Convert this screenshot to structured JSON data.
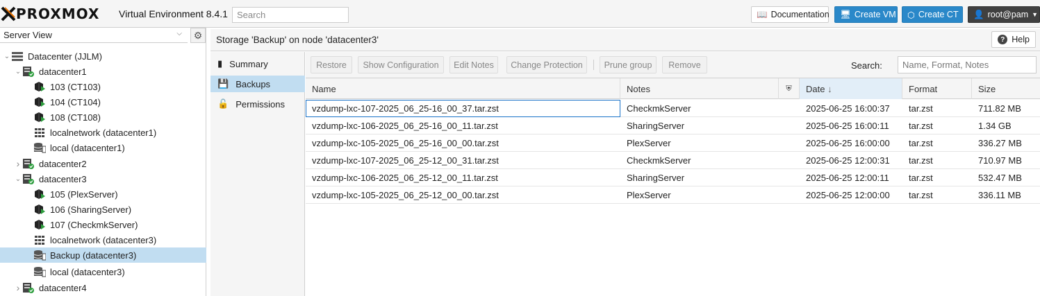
{
  "header": {
    "logo": "PROXMOX",
    "version": "Virtual Environment 8.4.1",
    "search_placeholder": "Search",
    "documentation": "Documentation",
    "create_vm": "Create VM",
    "create_ct": "Create CT",
    "user": "root@pam",
    "colors": {
      "accent": "#2a88c9",
      "logo_x": "#e57000"
    }
  },
  "sidebar": {
    "view": "Server View",
    "tree": [
      {
        "label": "Datacenter (JJLM)",
        "icon": "datacenter-icon",
        "expanded": true
      },
      {
        "label": "datacenter1",
        "icon": "node-icon",
        "expanded": true
      },
      {
        "label": "103 (CT103)",
        "icon": "container-running-icon"
      },
      {
        "label": "104 (CT104)",
        "icon": "container-running-icon"
      },
      {
        "label": "108 (CT108)",
        "icon": "container-running-icon"
      },
      {
        "label": "localnetwork (datacenter1)",
        "icon": "network-icon"
      },
      {
        "label": "local (datacenter1)",
        "icon": "storage-icon"
      },
      {
        "label": "datacenter2",
        "icon": "node-icon",
        "expanded": false
      },
      {
        "label": "datacenter3",
        "icon": "node-icon",
        "expanded": true
      },
      {
        "label": "105 (PlexServer)",
        "icon": "container-running-icon"
      },
      {
        "label": "106 (SharingServer)",
        "icon": "container-running-icon"
      },
      {
        "label": "107 (CheckmkServer)",
        "icon": "container-running-icon"
      },
      {
        "label": "localnetwork (datacenter3)",
        "icon": "network-icon"
      },
      {
        "label": "Backup (datacenter3)",
        "icon": "storage-icon",
        "selected": true
      },
      {
        "label": "local (datacenter3)",
        "icon": "storage-icon"
      },
      {
        "label": "datacenter4",
        "icon": "node-icon",
        "expanded": false
      }
    ]
  },
  "content": {
    "title": "Storage 'Backup' on node 'datacenter3'",
    "help": "Help",
    "nav": [
      {
        "label": "Summary",
        "icon": "book-icon"
      },
      {
        "label": "Backups",
        "icon": "floppy-icon",
        "selected": true
      },
      {
        "label": "Permissions",
        "icon": "unlock-icon"
      }
    ],
    "toolbar": {
      "restore": "Restore",
      "show_config": "Show Configuration",
      "edit_notes": "Edit Notes",
      "change_protection": "Change Protection",
      "prune_group": "Prune group",
      "remove": "Remove",
      "search_label": "Search:",
      "search_placeholder": "Name, Format, Notes"
    },
    "columns": [
      "Name",
      "Notes",
      "",
      "Date",
      "Format",
      "Size"
    ],
    "sort_indicator": "↓",
    "rows": [
      {
        "name": "vzdump-lxc-107-2025_06_25-16_00_37.tar.zst",
        "notes": "CheckmkServer",
        "date": "2025-06-25 16:00:37",
        "format": "tar.zst",
        "size": "711.82 MB"
      },
      {
        "name": "vzdump-lxc-106-2025_06_25-16_00_11.tar.zst",
        "notes": "SharingServer",
        "date": "2025-06-25 16:00:11",
        "format": "tar.zst",
        "size": "1.34 GB"
      },
      {
        "name": "vzdump-lxc-105-2025_06_25-16_00_00.tar.zst",
        "notes": "PlexServer",
        "date": "2025-06-25 16:00:00",
        "format": "tar.zst",
        "size": "336.27 MB"
      },
      {
        "name": "vzdump-lxc-107-2025_06_25-12_00_31.tar.zst",
        "notes": "CheckmkServer",
        "date": "2025-06-25 12:00:31",
        "format": "tar.zst",
        "size": "710.97 MB"
      },
      {
        "name": "vzdump-lxc-106-2025_06_25-12_00_11.tar.zst",
        "notes": "SharingServer",
        "date": "2025-06-25 12:00:11",
        "format": "tar.zst",
        "size": "532.47 MB"
      },
      {
        "name": "vzdump-lxc-105-2025_06_25-12_00_00.tar.zst",
        "notes": "PlexServer",
        "date": "2025-06-25 12:00:00",
        "format": "tar.zst",
        "size": "336.11 MB"
      }
    ]
  }
}
